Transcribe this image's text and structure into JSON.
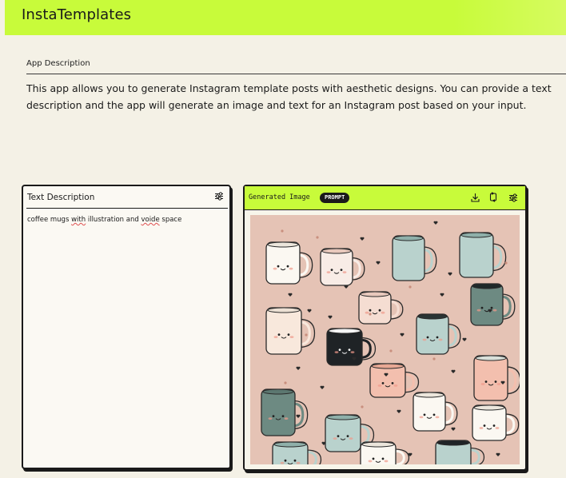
{
  "app": {
    "title": "InstaTemplates"
  },
  "description": {
    "label": "App Description",
    "text": "This app allows you to generate Instagram template posts with aesthetic designs. You can provide a text description and the app will generate an image and text for an Instagram post based on your input."
  },
  "input_panel": {
    "title": "Text Description",
    "value_parts": [
      "coffee mugs ",
      "with",
      " illustration and ",
      "voide",
      " space"
    ],
    "settings_icon": "sliders-icon"
  },
  "output_panel": {
    "title": "Generated Image",
    "badge": "PROMPT",
    "icons": [
      "download-icon",
      "regenerate-icon",
      "sliders-icon"
    ],
    "image_content": "illustration of cute coffee mugs with faces on a pink background"
  },
  "colors": {
    "accent": "#c8fb3a",
    "background": "#f4f1e6",
    "ink": "#1a1a1a",
    "art_background": "#e5c3b5"
  }
}
